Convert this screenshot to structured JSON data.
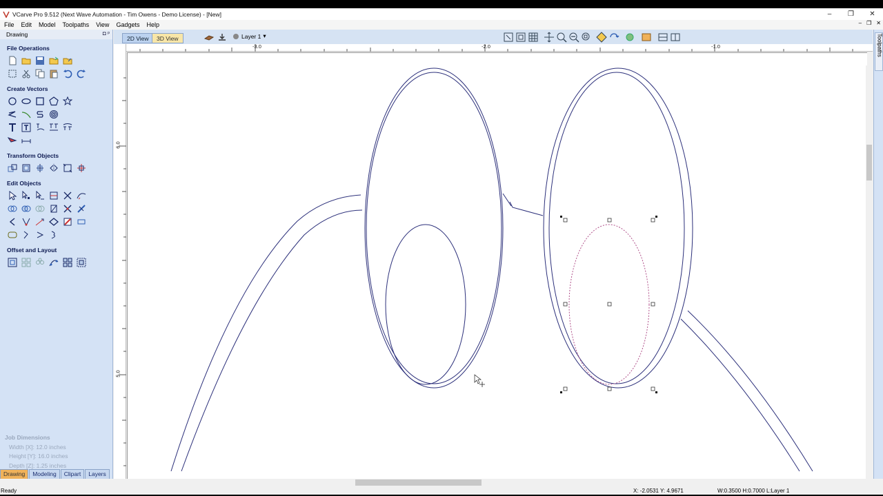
{
  "window": {
    "title": "VCarve Pro 9.512 (Next Wave Automation - Tim Owens - Demo License) - [New]",
    "minimize": "–",
    "maximize": "❐",
    "close": "✕"
  },
  "menu": {
    "items": [
      "File",
      "Edit",
      "Model",
      "Toolpaths",
      "View",
      "Gadgets",
      "Help"
    ],
    "mdi_minimize": "–",
    "mdi_restore": "❐",
    "mdi_close": "✕"
  },
  "left_panel": {
    "header": "Drawing",
    "pin_glyphs": "◘ ᵖ",
    "sections": {
      "file_operations": "File Operations",
      "create_vectors": "Create Vectors",
      "transform_objects": "Transform Objects",
      "edit_objects": "Edit Objects",
      "offset_layout": "Offset and Layout"
    },
    "job_dimensions": {
      "title": "Job Dimensions",
      "width": "Width  [X]: 12.0 inches",
      "height": "Height [Y]: 16.0 inches",
      "depth": "Depth  [Z]: 1.25 inches"
    },
    "tabs": [
      "Drawing",
      "Modeling",
      "Clipart",
      "Layers"
    ]
  },
  "right_strip": {
    "tab_label": "Toolpaths"
  },
  "view_toolbar": {
    "tab_2d": "2D View",
    "tab_3d": "3D View",
    "layer": "Layer 1",
    "layer_dropdown": "▾"
  },
  "rulers": {
    "h_ticks": [
      "-3.0",
      "-2.0",
      "-1.0"
    ],
    "v_ticks": [
      "6.0",
      "5.0"
    ]
  },
  "status": {
    "left": "Ready",
    "coords": "X: -2.0531 Y:  4.9671",
    "dims": "W:0.3500   H:0.7000   L:Layer 1"
  },
  "colors": {
    "vector": "#2b2f7a",
    "selected": "#b0508a",
    "panel_bg": "#d4e2f5",
    "active_tab": "#f0b25a"
  }
}
